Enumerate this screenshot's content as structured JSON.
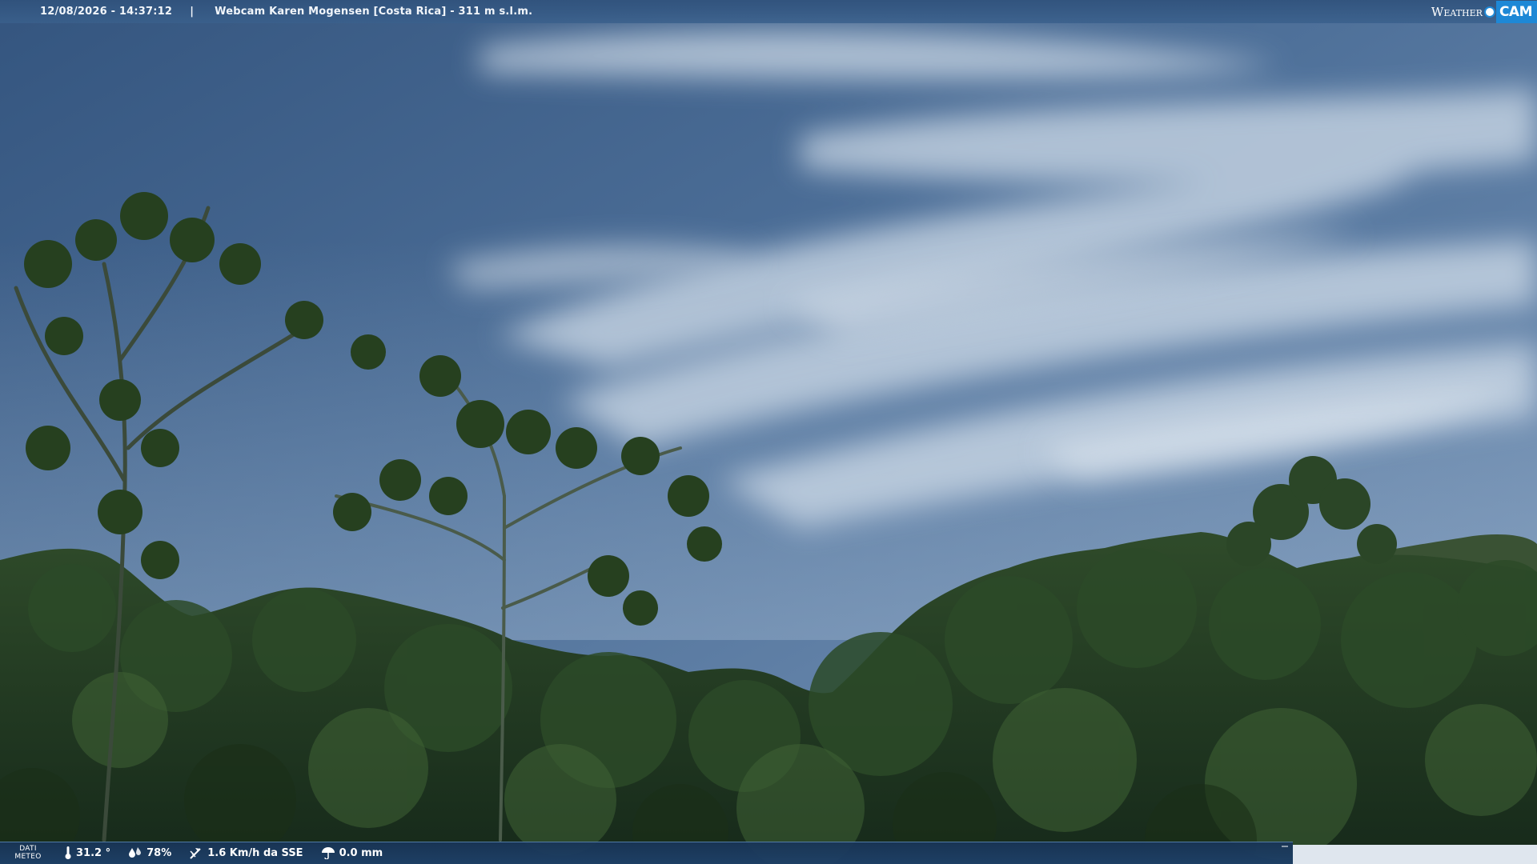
{
  "overlay": {
    "timestamp": "12/08/2026 - 14:37:12",
    "separator": "|",
    "title": "Webcam Karen Mogensen [Costa Rica] - 311 m s.l.m.",
    "logo": {
      "part1": "Weather",
      "part2": "CAM",
      "accent_color": "#1e88d6"
    }
  },
  "meteo": {
    "label_line1": "DATI",
    "label_line2": "METEO",
    "temperature": {
      "icon": "thermometer-icon",
      "value": "31.2 °"
    },
    "humidity": {
      "icon": "humidity-drops-icon",
      "value": "78%"
    },
    "wind": {
      "icon": "wind-vane-icon",
      "value": "1.6 Km/h da SSE"
    },
    "rain": {
      "icon": "umbrella-icon",
      "value": "0.0 mm"
    }
  },
  "scene": {
    "sky_color": "#4d6f99",
    "cloud_color": "#c8d6e4",
    "forest_color": "#1f3a1c"
  }
}
